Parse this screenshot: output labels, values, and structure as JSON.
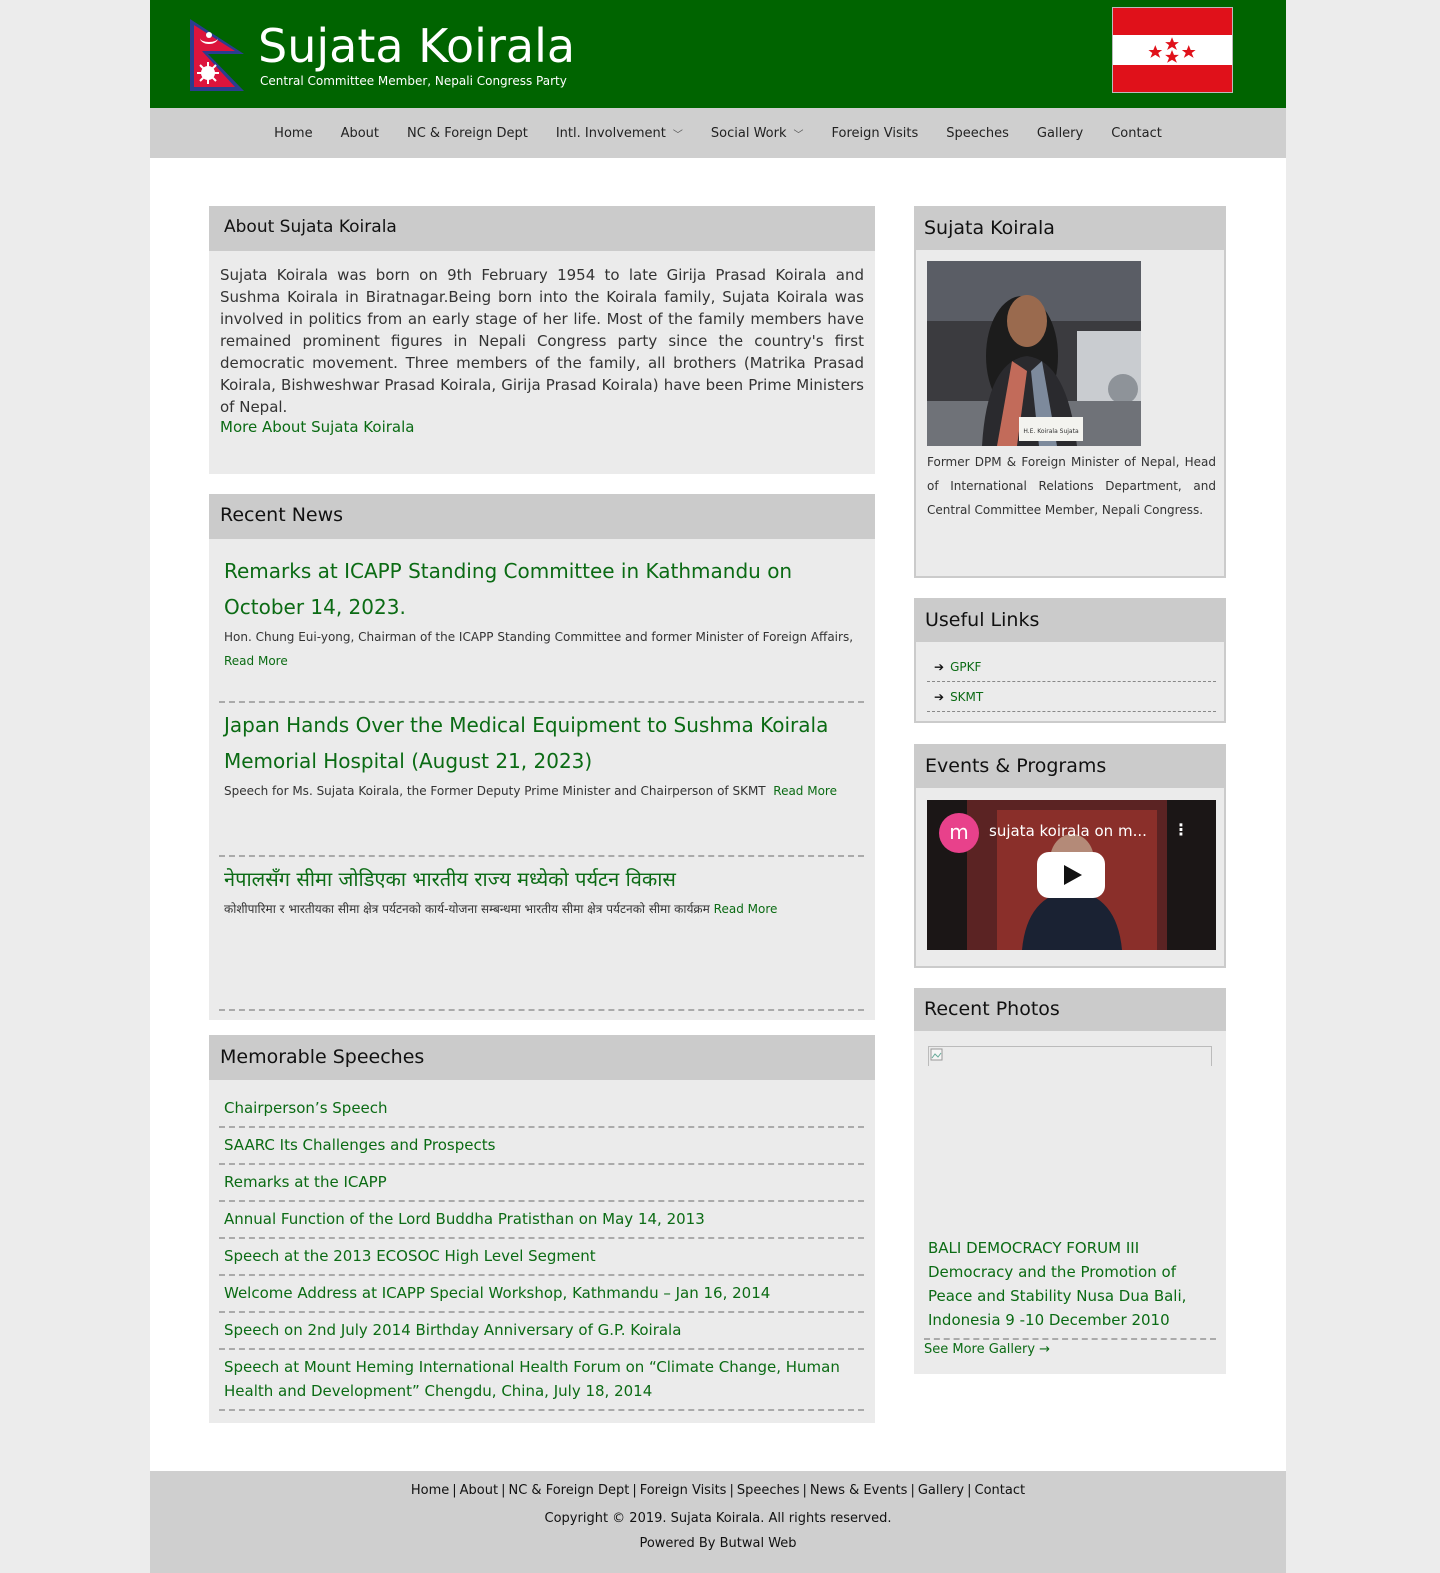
{
  "header": {
    "site_title": "Sujata Koirala",
    "site_subtitle": "Central Committee Member, Nepali Congress Party"
  },
  "nav": {
    "items": [
      {
        "label": "Home",
        "has_dropdown": false
      },
      {
        "label": "About",
        "has_dropdown": false
      },
      {
        "label": "NC & Foreign Dept",
        "has_dropdown": false
      },
      {
        "label": "Intl. Involvement",
        "has_dropdown": true
      },
      {
        "label": "Social Work",
        "has_dropdown": true
      },
      {
        "label": "Foreign Visits",
        "has_dropdown": false
      },
      {
        "label": "Speeches",
        "has_dropdown": false
      },
      {
        "label": "Gallery",
        "has_dropdown": false
      },
      {
        "label": "Contact",
        "has_dropdown": false
      }
    ]
  },
  "about": {
    "heading": "About Sujata Koirala",
    "body": "Sujata Koirala was born on 9th February 1954 to late Girija Prasad Koirala and Sushma Koirala in Biratnagar.Being born into the Koirala family, Sujata Koirala was involved in politics from an early stage of her life. Most of the family members have remained prominent figures in Nepali Congress party since the country's first democratic movement. Three members of the family, all brothers (Matrika Prasad Koirala, Bishweshwar Prasad Koirala, Girija Prasad Koirala) have been Prime Ministers of Nepal.",
    "more_link": "More About Sujata Koirala"
  },
  "recent_news": {
    "heading": "Recent News",
    "items": [
      {
        "title": "Remarks at ICAPP Standing Committee in Kathmandu on October 14, 2023.",
        "excerpt": "Hon. Chung Eui-yong, Chairman of the ICAPP Standing Committee and former Minister of Foreign Affairs,",
        "read_more": "Read More"
      },
      {
        "title": "Japan Hands Over the Medical Equipment to Sushma Koirala Memorial Hospital (August 21, 2023)",
        "excerpt": "Speech for Ms. Sujata Koirala, the Former Deputy Prime Minister and Chairperson of SKMT",
        "read_more": "Read More"
      },
      {
        "title": "नेपालसँग सीमा जोडिएका भारतीय राज्य मध्येको पर्यटन विकास",
        "excerpt": "कोशीपारिमा र भारतीयका सीमा क्षेत्र पर्यटनको कार्य-योजना सम्बन्धमा भारतीय सीमा क्षेत्र पर्यटनको सीमा कार्यक्रम",
        "read_more": "Read More"
      }
    ]
  },
  "memorable_speeches": {
    "heading": "Memorable Speeches",
    "items": [
      "Chairperson’s Speech",
      "SAARC Its Challenges and Prospects",
      "Remarks at the ICAPP",
      "Annual Function of the Lord Buddha Pratisthan on May 14, 2013",
      "Speech at the 2013 ECOSOC High Level Segment",
      "Welcome Address at ICAPP Special Workshop, Kathmandu – Jan 16, 2014",
      "Speech on 2nd July 2014 Birthday Anniversary of G.P. Koirala",
      "Speech at Mount Heming International Health Forum on “Climate Change, Human Health and Development” Chengdu, China, July 18, 2014"
    ]
  },
  "sidebar": {
    "profile": {
      "heading": "Sujata Koirala",
      "photo_nameplate": "H.E. Koirala Sujata",
      "description": "Former DPM & Foreign Minister of Nepal, Head of International Relations Department, and Central Committee Member, Nepali Congress."
    },
    "useful_links": {
      "heading": "Useful Links",
      "items": [
        "GPKF",
        "SKMT"
      ]
    },
    "events": {
      "heading": "Events & Programs",
      "video_title": "sujata koirala on m...",
      "channel_initial": "m"
    },
    "recent_photos": {
      "heading": "Recent Photos",
      "caption": "BALI DEMOCRACY FORUM III Democracy and the Promotion of Peace and Stability Nusa Dua Bali, Indonesia 9 -10 December 2010",
      "see_more": "See More Gallery →"
    }
  },
  "footer": {
    "links": [
      "Home",
      "About",
      "NC & Foreign Dept",
      "Foreign Visits",
      "Speeches",
      "News & Events",
      "Gallery",
      "Contact"
    ],
    "separator": "|",
    "copyright": "Copyright © 2019. Sujata Koirala. All rights reserved.",
    "powered_by": "Powered By Butwal Web"
  },
  "colors": {
    "header_green": "#006400",
    "link_green": "#0b6b14",
    "nav_gray": "#cfcfcf",
    "box_head_gray": "#cbcbcb",
    "box_body_gray": "#ebebeb",
    "flag_red": "#e0111a"
  }
}
